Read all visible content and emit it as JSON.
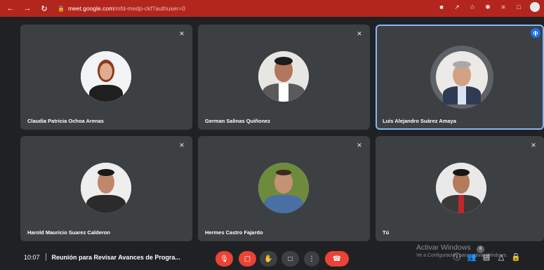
{
  "browser": {
    "back_icon": "arrow-left-icon",
    "forward_icon": "arrow-right-icon",
    "reload_icon": "reload-icon",
    "url_host": "meet.google.com",
    "url_path": "/mfd-medp-ckf?authuser=0",
    "bar_color": "#b3261e"
  },
  "participants": [
    {
      "name": "Claudia Patricia Ochoa Arenas",
      "muted": true,
      "speaking": false
    },
    {
      "name": "German Salinas Quiñonez",
      "muted": true,
      "speaking": false
    },
    {
      "name": "Luis Alejandro Suárez Amaya",
      "muted": false,
      "speaking": true
    },
    {
      "name": "Harold Mauricio Suarez Calderon",
      "muted": true,
      "speaking": false
    },
    {
      "name": "Hermes Castro Fajardo",
      "muted": true,
      "speaking": false
    },
    {
      "name": "Tú",
      "muted": true,
      "speaking": false
    }
  ],
  "meeting": {
    "time": "10:07",
    "title": "Reunión para Revisar Avances de Progra..."
  },
  "controls": {
    "mic": "mic-off-icon",
    "camera": "camera-off-icon",
    "raise_hand": "hand-icon",
    "present": "present-screen-icon",
    "more": "more-options-icon",
    "leave": "end-call-icon",
    "danger_color": "#ea4335"
  },
  "side_panel": {
    "info": "info-icon",
    "people": "people-icon",
    "people_count": "6",
    "chat": "chat-icon",
    "activities": "activities-icon",
    "host_controls": "lock-icon"
  },
  "watermark": {
    "line1": "Activar Windows",
    "line2": "Ve a Configuración para activar Windows."
  }
}
